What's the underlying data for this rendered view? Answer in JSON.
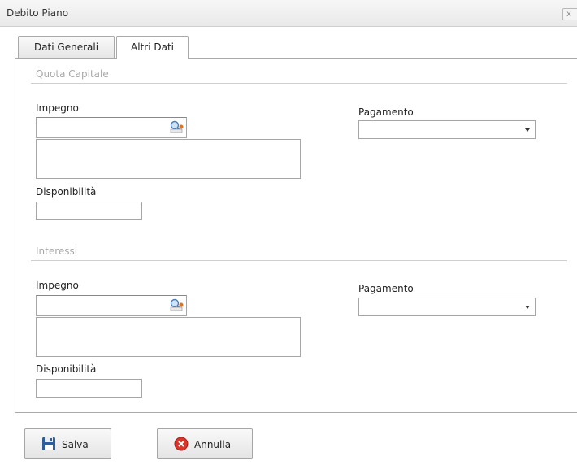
{
  "window": {
    "title": "Debito Piano",
    "close_label": "x"
  },
  "tabs": [
    {
      "label": "Dati Generali",
      "active": false
    },
    {
      "label": "Altri Dati",
      "active": true
    }
  ],
  "sections": [
    {
      "title": "Quota Capitale",
      "impegno_label": "Impegno",
      "impegno_value": "",
      "impegno_desc": "",
      "disponibilita_label": "Disponibilità",
      "disponibilita_value": "",
      "pagamento_label": "Pagamento",
      "pagamento_value": ""
    },
    {
      "title": "Interessi",
      "impegno_label": "Impegno",
      "impegno_value": "",
      "impegno_desc": "",
      "disponibilita_label": "Disponibilità",
      "disponibilita_value": "",
      "pagamento_label": "Pagamento",
      "pagamento_value": ""
    }
  ],
  "buttons": {
    "save_label": "Salva",
    "cancel_label": "Annulla"
  },
  "icons": {
    "lookup": "search-lookup-icon",
    "save": "floppy-disk-icon",
    "cancel": "red-x-circle-icon",
    "dropdown": "chevron-down-icon"
  },
  "colors": {
    "accent_cancel": "#d9362b",
    "save_icon": "#2f5f9a"
  }
}
